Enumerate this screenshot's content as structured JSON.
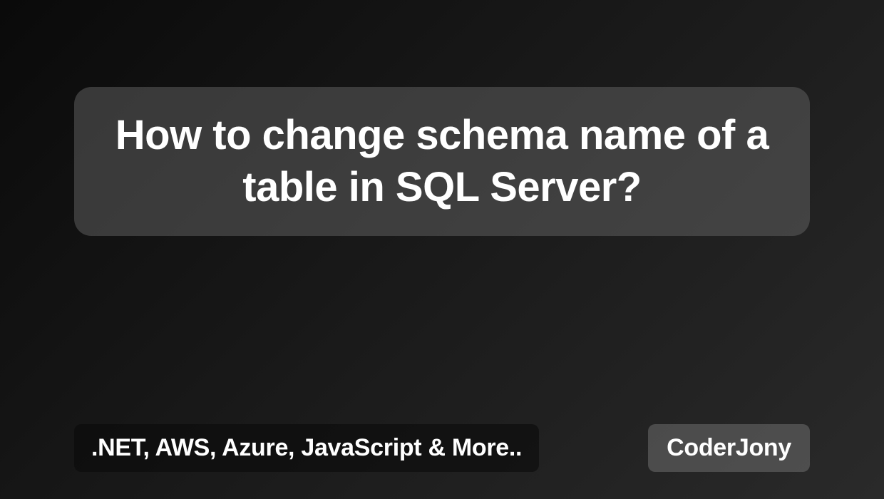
{
  "title": "How to change schema name of a table in SQL Server?",
  "tagline": ".NET, AWS, Azure, JavaScript & More..",
  "brand": "CoderJony"
}
